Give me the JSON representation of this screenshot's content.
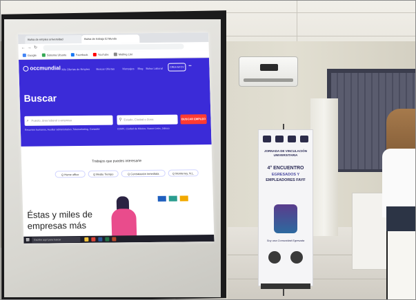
{
  "browser": {
    "tabs": [
      {
        "label": "Bolsa de empleo universidad",
        "state": "inactive"
      },
      {
        "label": "Bolsa de trabajo El Mundo",
        "state": "active"
      }
    ],
    "bookmarks": [
      "Google",
      "Sistema Ubuntu",
      "Facebook",
      "YouTube",
      "Mailing List"
    ]
  },
  "site": {
    "logo": "occmundial",
    "nav": [
      "Mis Ofertas de Empleo",
      "Buscar Ofertas",
      "Mensajes",
      "Blog",
      "Bolsa Laboral"
    ],
    "cv_button": "CREA MI CV",
    "search_title": "Buscar",
    "search_placeholder": "Puesto, área laboral o empresa",
    "location_placeholder": "Estado, Ciudad o Zona",
    "search_button": "BUSCAR EMPLEO",
    "suggestions_left": "Recursos humanos, Auxiliar administrativo, Telemarketing, Contador",
    "suggestions_right": "CDMX, Ciudad de México, Nuevo León, Jalisco",
    "interest_title": "Trabajos que puedes interesarte",
    "chips": [
      "Q Home office",
      "Q Medio Tiempo",
      "Q Contratación inmediata",
      "Q Monterrey, N.L."
    ],
    "headline_line1": "Éstas y miles de",
    "headline_line2": "empresas más"
  },
  "taskbar": {
    "search_text": "Escribe aquí para buscar"
  },
  "banner": {
    "line1": "JORNADA DE VINCULACIÓN",
    "line2": "UNIVERSITARIA",
    "line3": "4° ENCUENTRO",
    "line4": "EGRESADOS Y",
    "line5": "EMPLEADORES FAYF",
    "motto": "Soy una Comunidad Egresada"
  },
  "colors": {
    "occ_blue": "#3b2bd8",
    "search_button": "#ff3b30",
    "screen_frame": "#1b1b1c"
  }
}
